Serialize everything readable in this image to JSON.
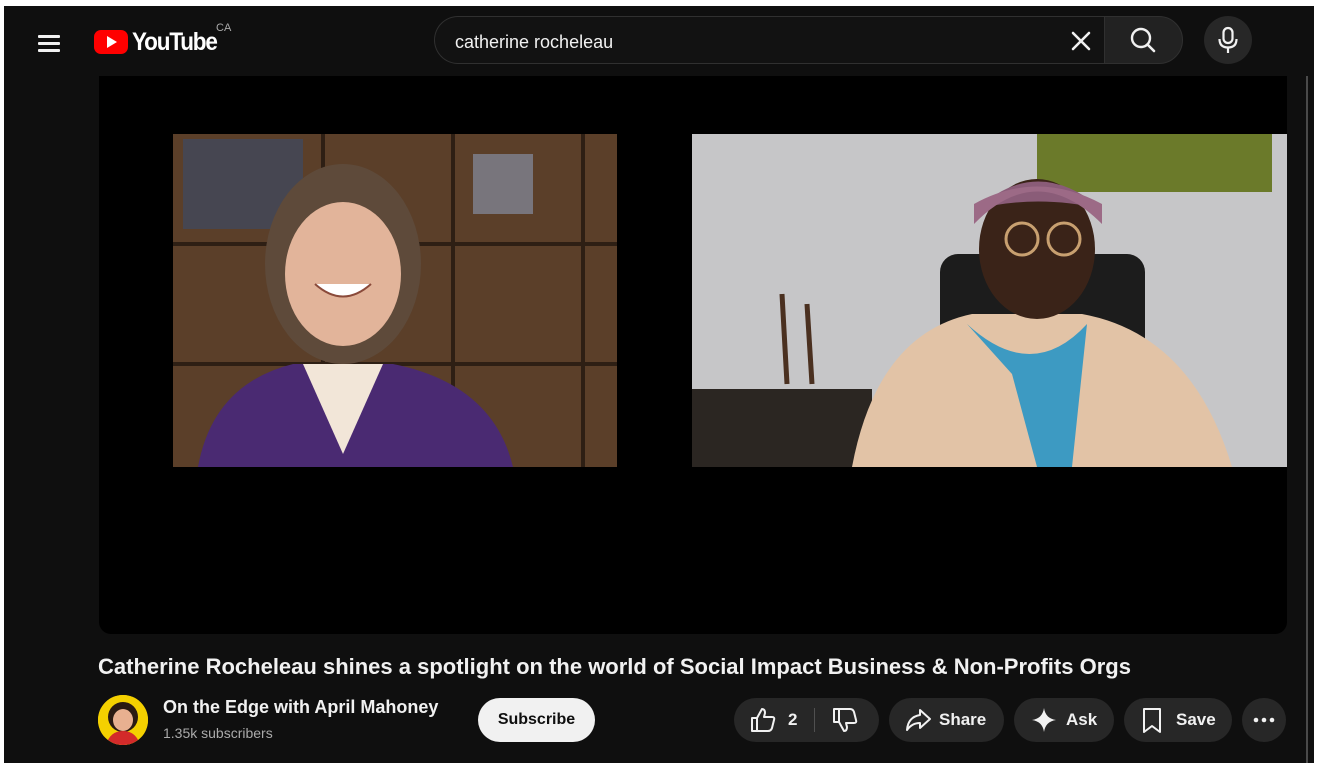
{
  "header": {
    "logo_text": "YouTube",
    "country_code": "CA",
    "search_query": "catherine rocheleau"
  },
  "video": {
    "title": "Catherine Rocheleau shines a spotlight on the world of Social Impact Business & Non-Profits Orgs"
  },
  "channel": {
    "name": "On the Edge with April Mahoney",
    "subscribers": "1.35k subscribers",
    "subscribe_label": "Subscribe"
  },
  "actions": {
    "like_count": "2",
    "share_label": "Share",
    "ask_label": "Ask",
    "save_label": "Save"
  },
  "colors": {
    "background": "#0f0f0f",
    "brand_red": "#ff0000",
    "pill_bg": "#272727",
    "subscribe_bg": "#f1f1f1"
  },
  "icons": [
    "menu-icon",
    "youtube-logo",
    "clear-icon",
    "search-icon",
    "mic-icon",
    "thumbs-up-icon",
    "thumbs-down-icon",
    "share-icon",
    "sparkle-icon",
    "bookmark-icon",
    "more-icon"
  ]
}
